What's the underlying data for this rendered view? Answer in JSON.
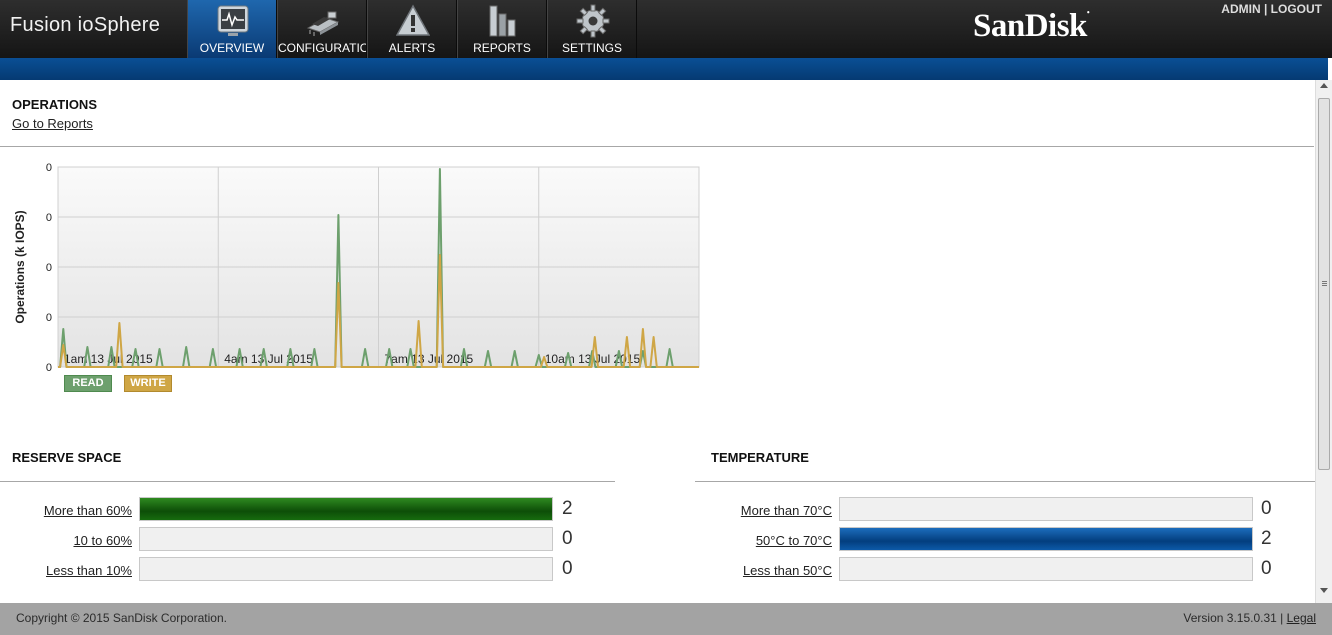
{
  "header": {
    "app_title": "Fusion ioSphere",
    "brand": "SanDisk",
    "admin_label": "ADMIN",
    "separator": "|",
    "logout_label": "LOGOUT"
  },
  "nav": [
    {
      "label": "OVERVIEW",
      "icon": "monitor-pulse-icon",
      "active": true
    },
    {
      "label": "CONFIGURATION",
      "icon": "circuit-board-icon",
      "active": false
    },
    {
      "label": "ALERTS",
      "icon": "warning-icon",
      "active": false
    },
    {
      "label": "REPORTS",
      "icon": "bar-chart-icon",
      "active": false
    },
    {
      "label": "SETTINGS",
      "icon": "gear-icon",
      "active": false
    }
  ],
  "operations": {
    "title": "OPERATIONS",
    "reports_link": "Go to Reports"
  },
  "chart_data": {
    "type": "line",
    "ylabel": "Operations (k IOPS)",
    "y_ticks": [
      "0",
      "0",
      "0",
      "0",
      "0"
    ],
    "x_ticks": [
      "1am 13 Jul 2015",
      "4am 13 Jul 2015",
      "7am 13 Jul 2015",
      "10am 13 Jul 2015"
    ],
    "ylim": [
      0,
      1
    ],
    "x_range": [
      0,
      12
    ],
    "grid": true,
    "legend_position": "bottom-left",
    "series": [
      {
        "name": "READ",
        "color": "#6da06d",
        "spikes": [
          [
            0.1,
            0.19
          ],
          [
            0.55,
            0.1
          ],
          [
            1.0,
            0.1
          ],
          [
            1.45,
            0.09
          ],
          [
            1.9,
            0.09
          ],
          [
            2.4,
            0.1
          ],
          [
            2.9,
            0.09
          ],
          [
            3.4,
            0.09
          ],
          [
            3.85,
            0.09
          ],
          [
            4.35,
            0.09
          ],
          [
            4.8,
            0.09
          ],
          [
            5.25,
            0.76
          ],
          [
            5.75,
            0.09
          ],
          [
            6.2,
            0.09
          ],
          [
            6.6,
            0.09
          ],
          [
            7.15,
            0.99
          ],
          [
            7.6,
            0.09
          ],
          [
            8.05,
            0.08
          ],
          [
            8.55,
            0.08
          ],
          [
            9.0,
            0.06
          ],
          [
            9.55,
            0.07
          ],
          [
            10.0,
            0.08
          ],
          [
            10.5,
            0.08
          ],
          [
            10.95,
            0.08
          ],
          [
            11.45,
            0.09
          ]
        ]
      },
      {
        "name": "WRITE",
        "color": "#cfa645",
        "spikes": [
          [
            0.1,
            0.11
          ],
          [
            1.15,
            0.22
          ],
          [
            5.25,
            0.42
          ],
          [
            6.75,
            0.23
          ],
          [
            7.15,
            0.56
          ],
          [
            9.1,
            0.05
          ],
          [
            10.05,
            0.15
          ],
          [
            10.65,
            0.15
          ],
          [
            10.95,
            0.19
          ],
          [
            11.15,
            0.15
          ]
        ]
      }
    ]
  },
  "reserve": {
    "title": "RESERVE SPACE",
    "rows": [
      {
        "label": "More than 60%",
        "count": "2",
        "fill": 1.0
      },
      {
        "label": "10 to 60%",
        "count": "0",
        "fill": 0
      },
      {
        "label": "Less than 10%",
        "count": "0",
        "fill": 0
      }
    ]
  },
  "temperature": {
    "title": "TEMPERATURE",
    "rows": [
      {
        "label": "More than 70°C",
        "count": "0",
        "fill": 0
      },
      {
        "label": "50°C to 70°C",
        "count": "2",
        "fill": 1.0
      },
      {
        "label": "Less than 50°C",
        "count": "0",
        "fill": 0
      }
    ]
  },
  "footer": {
    "copyright": "Copyright © 2015 SanDisk Corporation.",
    "version": "Version 3.15.0.31",
    "separator": "|",
    "legal_label": "Legal"
  }
}
